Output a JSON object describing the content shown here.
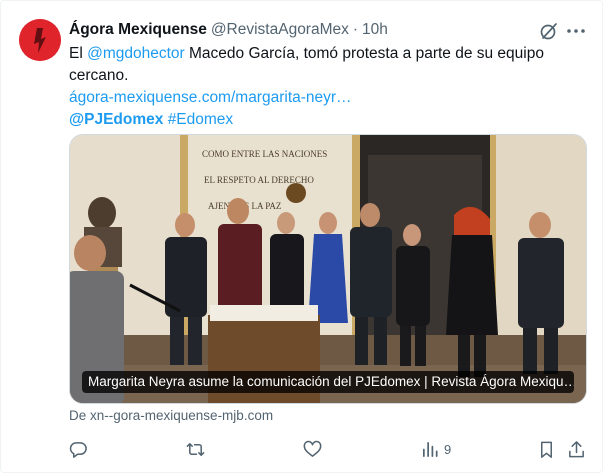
{
  "author": {
    "name": "Ágora Mexiquense",
    "handle": "@RevistaAgoraMex",
    "separator": "·",
    "time": "10h"
  },
  "tweet": {
    "line1_prefix": "El ",
    "mention": "@mgdohector",
    "line1_suffix": " Macedo García, tomó protesta a parte de su equipo",
    "line2": "cercano.",
    "link": "ágora-mexiquense.com/margarita-neyr…",
    "hashtag_mention": "@PJEdomex",
    "hashtag": "#Edomex"
  },
  "media": {
    "caption": "Margarita Neyra asume la comunicación del PJEdomex | Revista Ágora Mexiqu…",
    "wall_text_1": "COMO ENTRE LAS NACIONES",
    "wall_text_2": "EL RESPETO AL DERECHO",
    "wall_text_3": "AJENO ES LA PAZ"
  },
  "source": "De xn--gora-mexiquense-mjb.com",
  "actions": {
    "views": "9"
  },
  "colors": {
    "link": "#1d9bf0",
    "muted": "#536471",
    "avatar": "#e0242b"
  },
  "icons": [
    "grok-icon",
    "more-icon",
    "reply-icon",
    "retweet-icon",
    "like-icon",
    "views-icon",
    "bookmark-icon",
    "share-icon"
  ]
}
